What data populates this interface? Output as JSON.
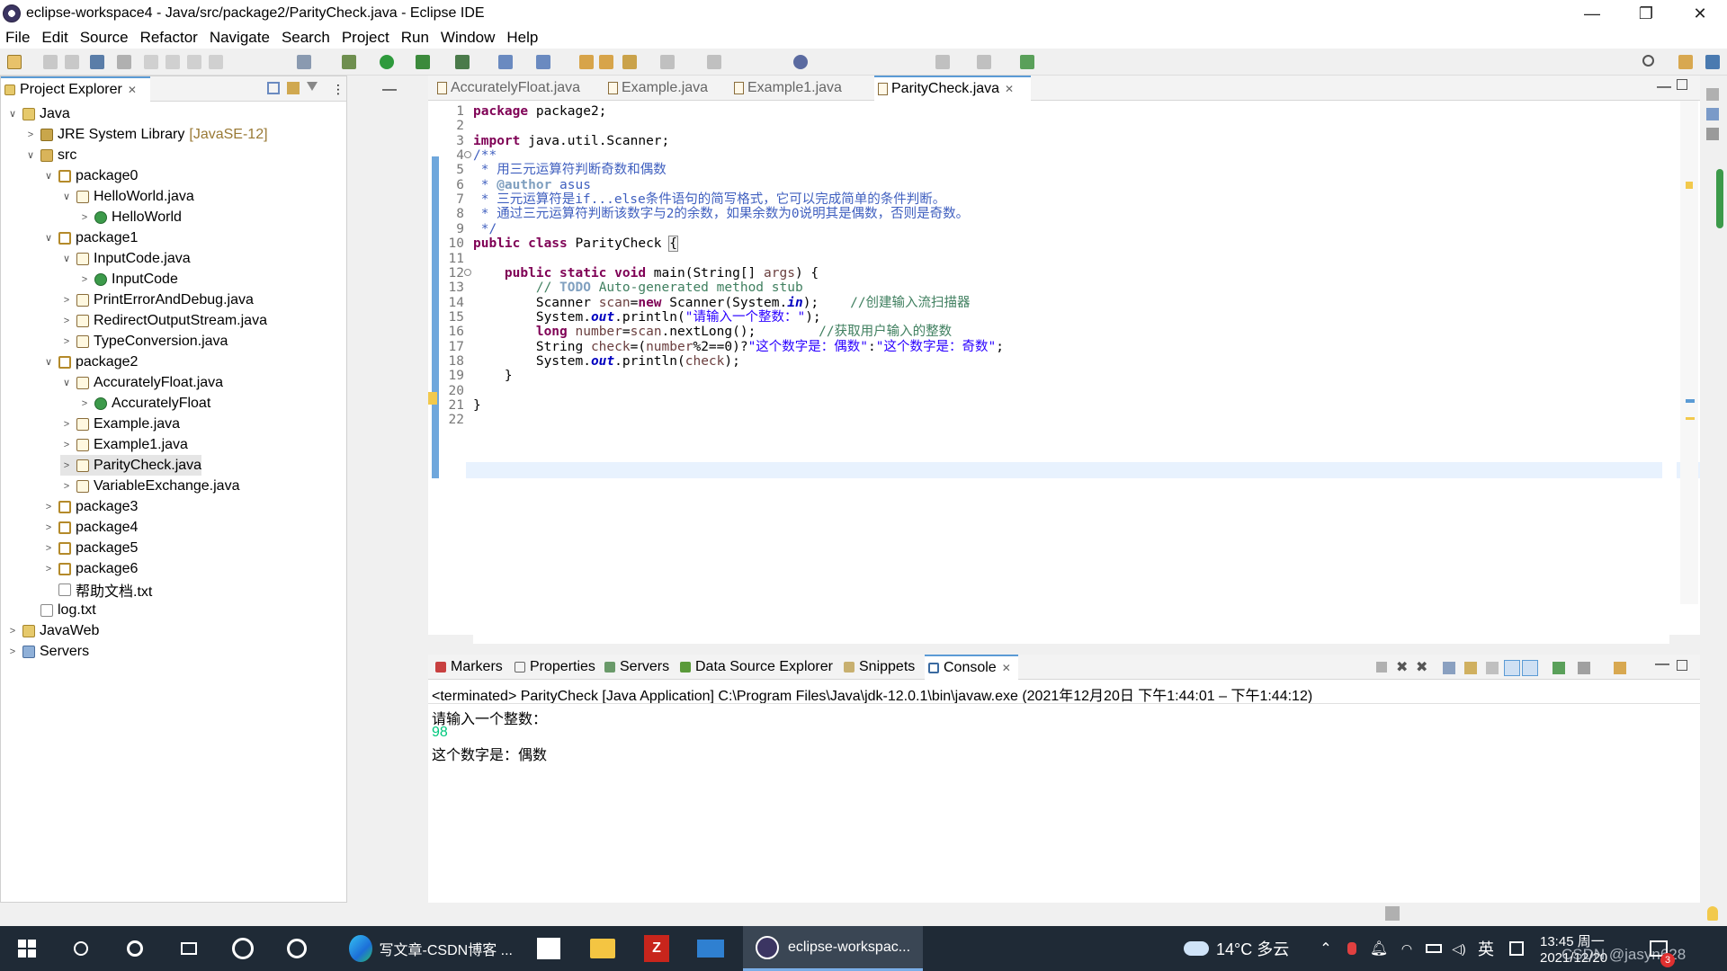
{
  "window": {
    "title": "eclipse-workspace4 - Java/src/package2/ParityCheck.java - Eclipse IDE",
    "minimize": "—",
    "restore": "❐",
    "close": "✕"
  },
  "menu": [
    "File",
    "Edit",
    "Source",
    "Refactor",
    "Navigate",
    "Search",
    "Project",
    "Run",
    "Window",
    "Help"
  ],
  "project_explorer": {
    "title": "Project Explorer",
    "items": [
      {
        "label": "Java",
        "icon": "project-icon",
        "twisty": "∨"
      },
      {
        "label": "JRE System Library",
        "suffix": "[JavaSE-12]",
        "icon": "library-icon",
        "twisty": ">"
      },
      {
        "label": "src",
        "icon": "source-folder-icon",
        "twisty": "∨"
      },
      {
        "label": "package0",
        "icon": "package-icon",
        "twisty": "∨"
      },
      {
        "label": "HelloWorld.java",
        "icon": "java-file-icon",
        "twisty": "∨"
      },
      {
        "label": "HelloWorld",
        "icon": "class-icon",
        "twisty": ">"
      },
      {
        "label": "package1",
        "icon": "package-icon",
        "twisty": "∨"
      },
      {
        "label": "InputCode.java",
        "icon": "java-file-icon",
        "twisty": "∨"
      },
      {
        "label": "InputCode",
        "icon": "class-icon",
        "twisty": ">"
      },
      {
        "label": "PrintErrorAndDebug.java",
        "icon": "java-file-icon",
        "twisty": ">"
      },
      {
        "label": "RedirectOutputStream.java",
        "icon": "java-file-icon",
        "twisty": ">"
      },
      {
        "label": "TypeConversion.java",
        "icon": "java-file-icon",
        "twisty": ">"
      },
      {
        "label": "package2",
        "icon": "package-icon",
        "twisty": "∨"
      },
      {
        "label": "AccuratelyFloat.java",
        "icon": "java-file-icon",
        "twisty": "∨"
      },
      {
        "label": "AccuratelyFloat",
        "icon": "class-icon",
        "twisty": ">"
      },
      {
        "label": "Example.java",
        "icon": "java-file-icon",
        "twisty": ">"
      },
      {
        "label": "Example1.java",
        "icon": "java-file-icon",
        "twisty": ">"
      },
      {
        "label": "ParityCheck.java",
        "icon": "java-file-icon",
        "twisty": ">"
      },
      {
        "label": "VariableExchange.java",
        "icon": "java-file-icon",
        "twisty": ">"
      },
      {
        "label": "package3",
        "icon": "package-icon",
        "twisty": ">"
      },
      {
        "label": "package4",
        "icon": "package-icon",
        "twisty": ">"
      },
      {
        "label": "package5",
        "icon": "package-icon",
        "twisty": ">"
      },
      {
        "label": "package6",
        "icon": "package-icon",
        "twisty": ">"
      },
      {
        "label": "帮助文档.txt",
        "icon": "text-file-icon",
        "twisty": ""
      },
      {
        "label": "log.txt",
        "icon": "text-file-icon",
        "twisty": ""
      },
      {
        "label": "JavaWeb",
        "icon": "project-icon",
        "twisty": ">"
      },
      {
        "label": "Servers",
        "icon": "servers-folder-icon",
        "twisty": ">"
      }
    ]
  },
  "editor": {
    "tabs": [
      "AccuratelyFloat.java",
      "Example.java",
      "Example1.java",
      "ParityCheck.java"
    ],
    "active_tab": "ParityCheck.java",
    "lines": [
      "1",
      "2",
      "3",
      "4",
      "5",
      "6",
      "7",
      "8",
      "9",
      "10",
      "11",
      "12",
      "13",
      "14",
      "15",
      "16",
      "17",
      "18",
      "19",
      "20",
      "21",
      "22"
    ],
    "code": {
      "l1_kw": "package",
      "l1_rest": " package2;",
      "l3_kw": "import",
      "l3_rest": " java.util.Scanner;",
      "l4": "/**",
      "l5": " * 用三元运算符判断奇数和偶数",
      "l6_a": " * ",
      "l6_tag": "@author",
      "l6_b": " asus",
      "l7": " * 三元运算符是if...else条件语句的简写格式，它可以完成简单的条件判断。",
      "l8": " * 通过三元运算符判断该数字与2的余数，如果余数为0说明其是偶数，否则是奇数。",
      "l9": " */",
      "l10_kw": "public class",
      "l10_rest": " ParityCheck ",
      "l10_brace": "{",
      "l12_indent": "    ",
      "l12_kw": "public static void",
      "l12_rest": " main(String[] ",
      "l12_var": "args",
      "l12_end": ") {",
      "l13_indent": "        ",
      "l13_a": "// ",
      "l13_tag": "TODO",
      "l13_b": " Auto-generated method stub",
      "l14_a": "        Scanner ",
      "l14_var": "scan",
      "l14_eq": "=",
      "l14_kw": "new",
      "l14_b": " Scanner(System.",
      "l14_fld": "in",
      "l14_c": ");    ",
      "l14_cm": "//创建输入流扫描器",
      "l15_a": "        System.",
      "l15_fld": "out",
      "l15_b": ".println(",
      "l15_str": "\"请输入一个整数：\"",
      "l15_c": ");",
      "l16_indent": "        ",
      "l16_kw": "long",
      "l16_sp": " ",
      "l16_var": "number",
      "l16_b": "=",
      "l16_var2": "scan",
      "l16_c": ".nextLong();        ",
      "l16_cm": "//获取用户输入的整数",
      "l17_a": "        String ",
      "l17_var": "check",
      "l17_b": "=(",
      "l17_var2": "number",
      "l17_c": "%2==0)?",
      "l17_str1": "\"这个数字是：偶数\"",
      "l17_d": ":",
      "l17_str2": "\"这个数字是：奇数\"",
      "l17_e": ";",
      "l18_a": "        System.",
      "l18_fld": "out",
      "l18_b": ".println(",
      "l18_var": "check",
      "l18_c": ");",
      "l19": "    }",
      "l21": "}"
    }
  },
  "bottom_panel": {
    "tabs": [
      "Markers",
      "Properties",
      "Servers",
      "Data Source Explorer",
      "Snippets",
      "Console"
    ],
    "active_tab": "Console",
    "header": "<terminated> ParityCheck [Java Application] C:\\Program Files\\Java\\jdk-12.0.1\\bin\\javaw.exe  (2021年12月20日 下午1:44:01 – 下午1:44:12)",
    "output": [
      "请输入一个整数：",
      "98",
      "这个数字是：偶数"
    ]
  },
  "taskbar": {
    "apps": [
      {
        "label": "写文章-CSDN博客 ...",
        "icon": "edge-browser-icon"
      },
      {
        "label": "eclipse-workspac...",
        "icon": "eclipse-icon"
      }
    ],
    "weather": "14°C  多云",
    "ime": "英",
    "time": "13:45 周一",
    "date": "2021/12/20",
    "watermark": "CSDN @jasyn628",
    "notification_count": "3"
  },
  "colors": {
    "keyword": "#7f0055",
    "comment_doc": "#3f5fbf",
    "comment_line": "#3f7f5f",
    "string": "#2a00ff",
    "field": "#0000c0",
    "local_var": "#6a3e3e",
    "console_input": "#00c87d",
    "taskbar": "#1f2a36"
  }
}
